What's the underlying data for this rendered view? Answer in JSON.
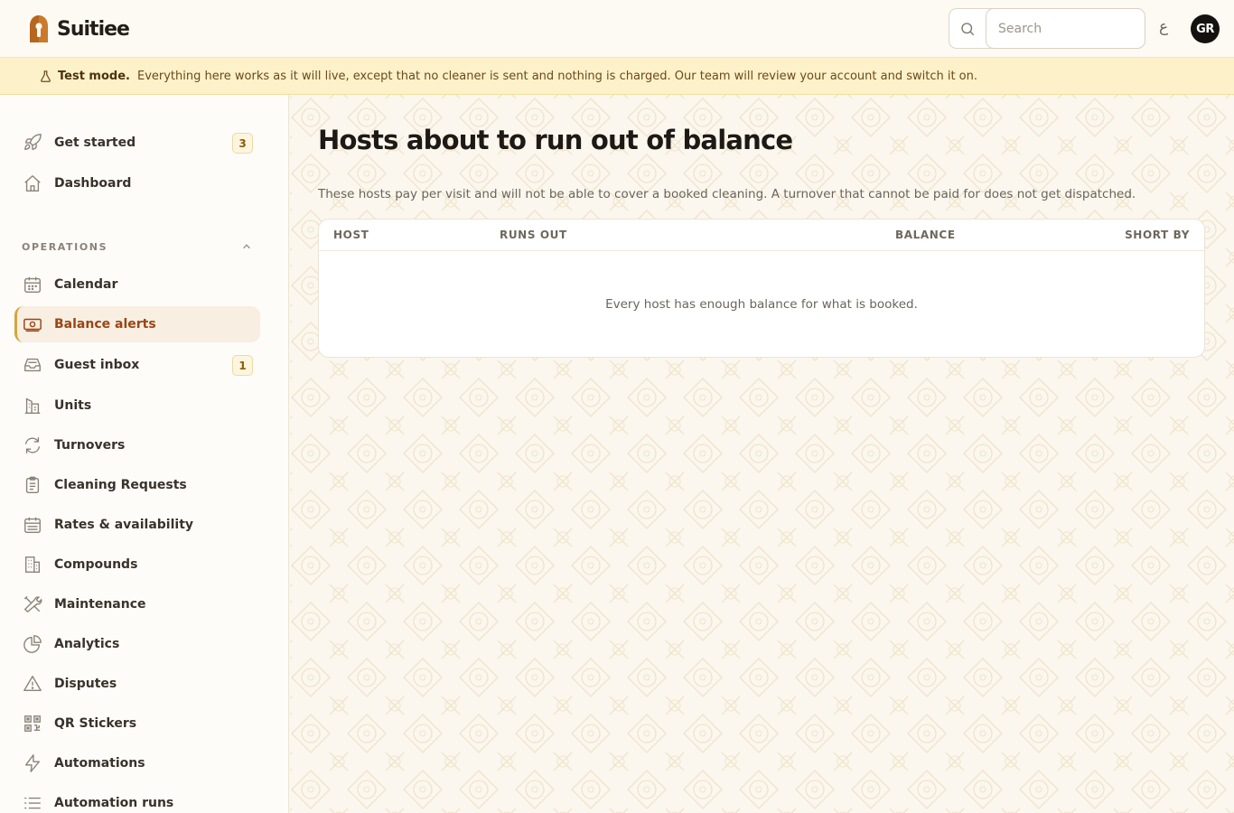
{
  "app": {
    "brand": "Suitiee",
    "search_placeholder": "Search",
    "lang_toggle": "ع",
    "user_initials": "GR"
  },
  "banner": {
    "bold": "Test mode.",
    "text": "Everything here works as it will live, except that no cleaner is sent and nothing is charged. Our team will review your account and switch it on."
  },
  "sidebar": {
    "top_items": [
      {
        "label": "Get started",
        "icon": "rocket-icon",
        "badge": "3"
      },
      {
        "label": "Dashboard",
        "icon": "home-icon"
      }
    ],
    "section_label": "OPERATIONS",
    "items": [
      {
        "label": "Calendar",
        "icon": "calendar-icon"
      },
      {
        "label": "Balance alerts",
        "icon": "banknote-icon",
        "active": true
      },
      {
        "label": "Guest inbox",
        "icon": "inbox-icon",
        "badge": "1"
      },
      {
        "label": "Units",
        "icon": "building-icon"
      },
      {
        "label": "Turnovers",
        "icon": "refresh-icon"
      },
      {
        "label": "Cleaning Requests",
        "icon": "clipboard-icon"
      },
      {
        "label": "Rates & availability",
        "icon": "calendar-grid-icon"
      },
      {
        "label": "Compounds",
        "icon": "office-building-icon"
      },
      {
        "label": "Maintenance",
        "icon": "tools-icon"
      },
      {
        "label": "Analytics",
        "icon": "pie-chart-icon"
      },
      {
        "label": "Disputes",
        "icon": "warning-icon"
      },
      {
        "label": "QR Stickers",
        "icon": "qr-code-icon"
      },
      {
        "label": "Automations",
        "icon": "lightning-icon"
      },
      {
        "label": "Automation runs",
        "icon": "list-icon"
      }
    ]
  },
  "main": {
    "title": "Hosts about to run out of balance",
    "description": "These hosts pay per visit and will not be able to cover a booked cleaning. A turnover that cannot be paid for does not get dispatched.",
    "table": {
      "columns": [
        "HOST",
        "RUNS OUT",
        "BALANCE",
        "SHORT BY"
      ],
      "empty_message": "Every host has enough balance for what is booked."
    }
  },
  "colors": {
    "accent": "#9a4514",
    "active_border": "#d3a53d",
    "banner_bg": "#fdf1c9",
    "page_bg": "#fbf7ee"
  }
}
